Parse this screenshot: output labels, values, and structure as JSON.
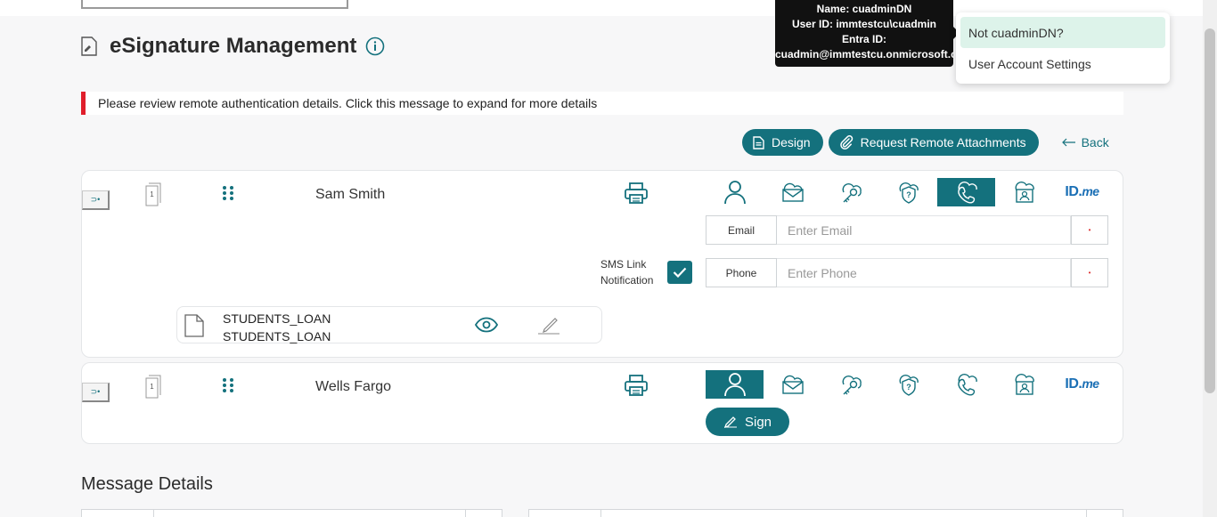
{
  "page": {
    "title": "eSignature Management",
    "alert": "Please review remote authentication details. Click this message to expand for more details",
    "section_title": "Message Details"
  },
  "actions": {
    "design_label": "Design",
    "request_label": "Request Remote Attachments",
    "back_label": "Back"
  },
  "colors": {
    "accent": "#14717d",
    "alert_bar": "#e01e2b",
    "menu_highlight": "#ddf3ea",
    "idme_blue": "#1a6fb5"
  },
  "signers": [
    {
      "name": "Sam Smith",
      "page_count": "1",
      "active_auth": "phone-auth",
      "email_label": "Email",
      "email_placeholder": "Enter Email",
      "phone_label": "Phone",
      "phone_placeholder": "Enter Phone",
      "sms_line1": "SMS Link",
      "sms_line2": "Notification",
      "sms_checked": true,
      "document_line1": "STUDENTS_LOAN",
      "document_line2": "STUDENTS_LOAN"
    },
    {
      "name": "Wells Fargo",
      "page_count": "1",
      "active_auth": "in-person",
      "sign_label": "Sign"
    }
  ],
  "auth_icons": [
    "person-icon",
    "email-icon",
    "cloud-key-icon",
    "shield-question-icon",
    "phone-icon",
    "cloud-id-icon",
    "idme-logo"
  ],
  "idme": {
    "id": "ID.",
    "me": "me"
  },
  "tooltip": {
    "line1": "Name: cuadminDN",
    "line2": "User ID: immtestcu\\cuadmin",
    "line3": "Entra ID:",
    "line4": "cuadmin@immtestcu.onmicrosoft.com"
  },
  "user_menu": {
    "items": [
      {
        "label": "Not cuadminDN?"
      },
      {
        "label": "User Account Settings"
      }
    ]
  }
}
